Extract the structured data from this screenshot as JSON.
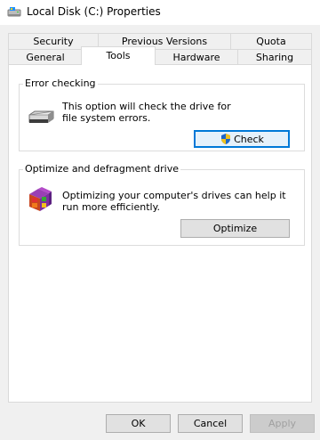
{
  "window": {
    "title": "Local Disk (C:) Properties",
    "title_icon": "drive-icon"
  },
  "tabs": {
    "row1": [
      {
        "label": "Security"
      },
      {
        "label": "Previous Versions"
      },
      {
        "label": "Quota"
      }
    ],
    "row2": [
      {
        "label": "General"
      },
      {
        "label": "Tools",
        "active": true
      },
      {
        "label": "Hardware"
      },
      {
        "label": "Sharing"
      }
    ]
  },
  "error_checking": {
    "title": "Error checking",
    "description": "This option will check the drive for file system errors.",
    "button_label": "Check",
    "icon": "hard-drive-icon",
    "button_icon": "uac-shield-icon"
  },
  "optimize": {
    "title": "Optimize and defragment drive",
    "description": "Optimizing your computer's drives can help it run more efficiently.",
    "button_label": "Optimize",
    "icon": "defrag-icon"
  },
  "footer": {
    "ok_label": "OK",
    "cancel_label": "Cancel",
    "apply_label": "Apply"
  },
  "colors": {
    "dialog_bg": "#f0f0f0",
    "panel_bg": "#ffffff",
    "focus_border": "#0078d7",
    "disabled_text": "#a0a0a0"
  }
}
